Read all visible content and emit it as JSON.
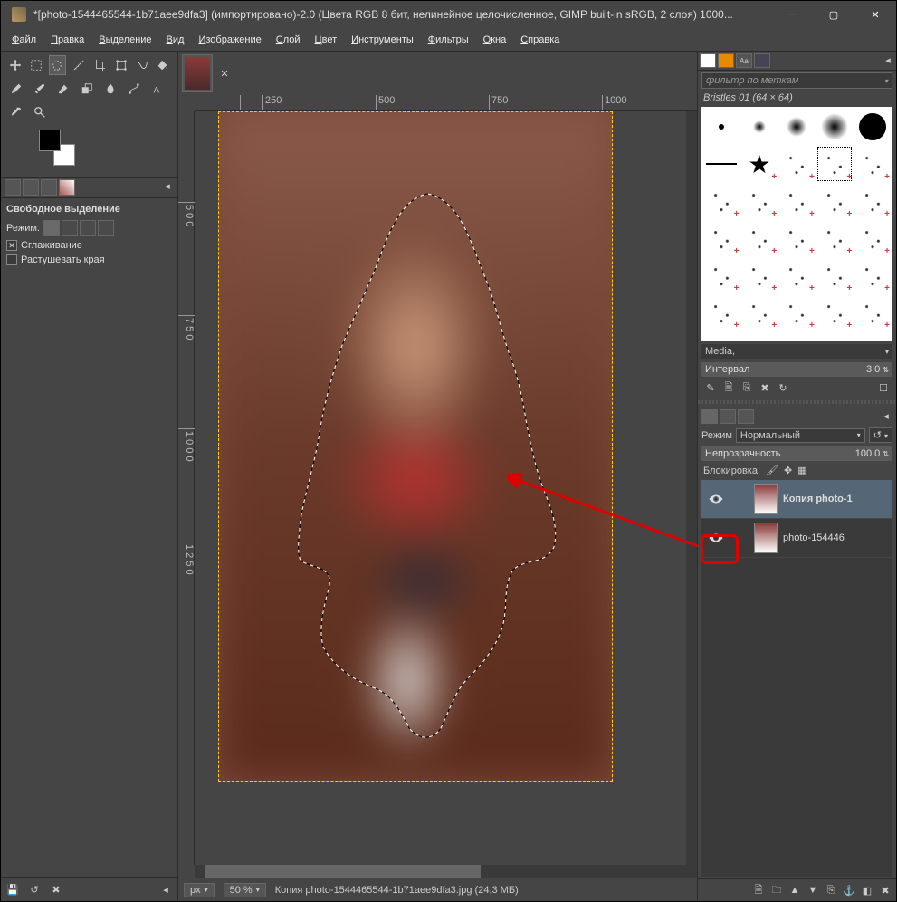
{
  "window": {
    "title": "*[photo-1544465544-1b71aee9dfa3] (импортировано)-2.0 (Цвета RGB 8 бит, нелинейное целочисленное, GIMP built-in sRGB, 2 слоя) 1000..."
  },
  "menu": {
    "file": "Файл",
    "edit": "Правка",
    "select": "Выделение",
    "view": "Вид",
    "image": "Изображение",
    "layer": "Слой",
    "colors": "Цвет",
    "tools": "Инструменты",
    "filters": "Фильтры",
    "windows": "Окна",
    "help": "Справка"
  },
  "tool_options": {
    "title": "Свободное выделение",
    "mode_label": "Режим:",
    "antialias": "Сглаживание",
    "feather": "Растушевать края"
  },
  "ruler_h": [
    "250",
    "500",
    "750",
    "1000"
  ],
  "ruler_v": [
    "5\n0\n0",
    "7\n5\n0",
    "1\n0\n0\n0",
    "1\n2\n5\n0"
  ],
  "status": {
    "unit": "px",
    "zoom": "50 %",
    "text": "Копия photo-1544465544-1b71aee9dfa3.jpg (24,3 МБ)"
  },
  "brushes": {
    "filter_placeholder": "фильтр по меткам",
    "current": "Bristles 01 (64 × 64)",
    "media": "Media,",
    "interval_label": "Интервал",
    "interval_value": "3,0"
  },
  "layers": {
    "mode_label": "Режим",
    "mode_value": "Нормальный",
    "opacity_label": "Непрозрачность",
    "opacity_value": "100,0",
    "lock_label": "Блокировка:",
    "items": [
      {
        "name": "Копия photo-1",
        "visible": true,
        "selected": true
      },
      {
        "name": "photo-154446",
        "visible": true,
        "selected": false
      }
    ]
  }
}
